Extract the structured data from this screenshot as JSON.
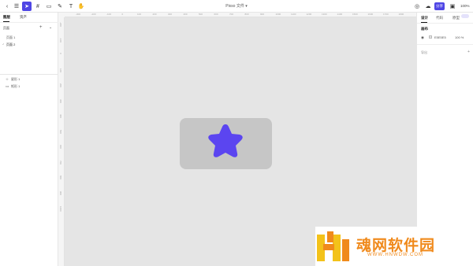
{
  "toolbar": {
    "file_title": "Pixso 文件 ▾",
    "share_label": "分享",
    "zoom": "100%"
  },
  "ruler": {
    "x_ticks": [
      "-300",
      "-200",
      "-100",
      "0",
      "100",
      "200",
      "300",
      "400",
      "500",
      "600",
      "700",
      "800",
      "900",
      "1000",
      "1100",
      "1200",
      "1300",
      "1400",
      "1500",
      "1600",
      "1700",
      "1800"
    ],
    "y_ticks": [
      "-200",
      "-100",
      "0",
      "100",
      "200",
      "300",
      "400",
      "500",
      "600",
      "700",
      "800",
      "900",
      "1000"
    ]
  },
  "left_panel": {
    "tabs": [
      {
        "label": "图层"
      },
      {
        "label": "资产"
      }
    ],
    "pages_title": "页面",
    "pages": [
      {
        "label": "页面 1"
      },
      {
        "label": "页面 2"
      }
    ],
    "layers": [
      {
        "label": "星形 1"
      },
      {
        "label": "矩形 1"
      }
    ]
  },
  "right_panel": {
    "tabs": [
      {
        "label": "设计"
      },
      {
        "label": "代码"
      },
      {
        "label": "原型"
      }
    ],
    "section_title": "画布",
    "fill_hex": "E5E5E5",
    "fill_opacity": "100 %",
    "export_label": "导出"
  },
  "canvas": {
    "background": "#e5e5e5",
    "frame_color": "#c6c6c6",
    "star_color": "#5b45f0"
  },
  "watermark": {
    "title": "魂网软件园",
    "url": "WWW.HNWDW.COM"
  }
}
